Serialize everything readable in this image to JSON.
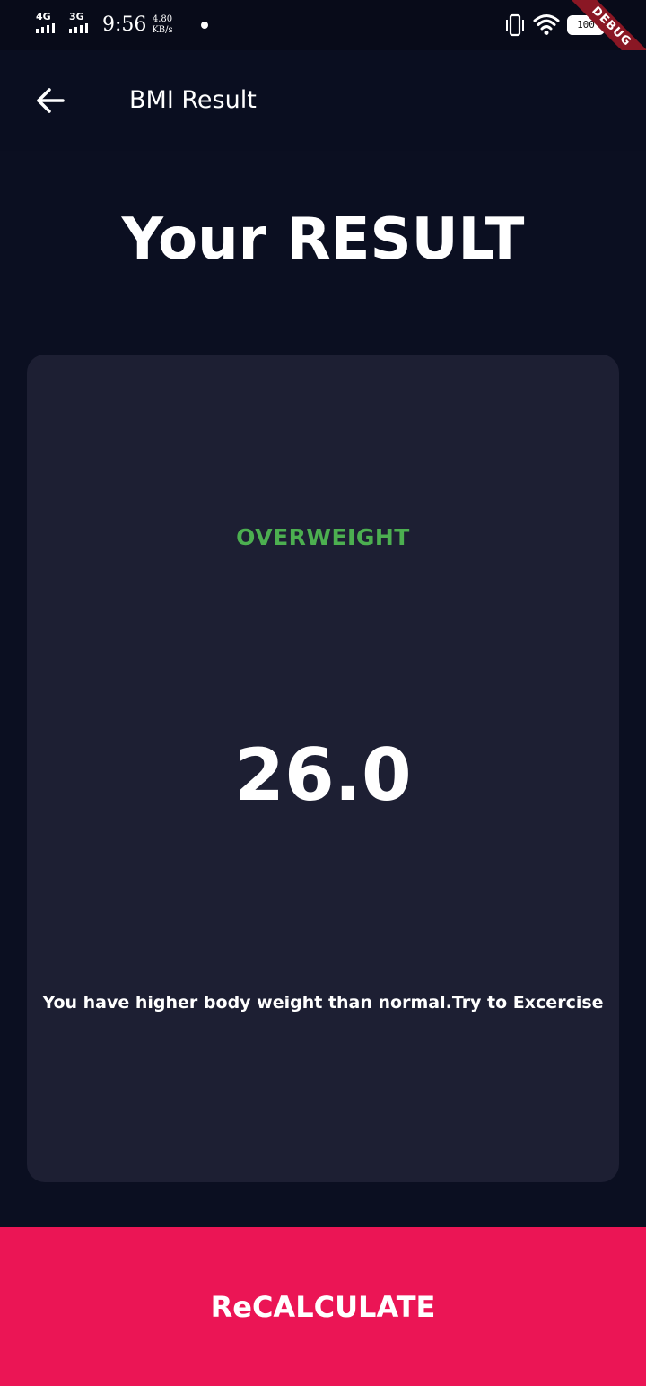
{
  "status_bar": {
    "network_1": "4G",
    "network_2": "3G",
    "time": "9:56",
    "speed_value": "4.80",
    "speed_unit": "KB/s",
    "battery": "100",
    "icons": [
      "signal-icon",
      "vibrate-icon",
      "wifi-icon",
      "battery-icon"
    ]
  },
  "debug_banner": "DEBUG",
  "app_bar": {
    "back_icon": "arrow-left-icon",
    "title": "BMI Result"
  },
  "page": {
    "heading": "Your RESULT"
  },
  "result": {
    "category": "OVERWEIGHT",
    "value": "26.0",
    "message": "You have higher body weight than normal.Try to Excercise"
  },
  "action": {
    "label": "ReCALCULATE"
  },
  "colors": {
    "background": "#0b0f21",
    "app_bar": "#0a0e20",
    "card": "#1d1f33",
    "category": "#4caf50",
    "button": "#eb1555",
    "text": "#ffffff",
    "debug_banner": "#8a1724"
  }
}
